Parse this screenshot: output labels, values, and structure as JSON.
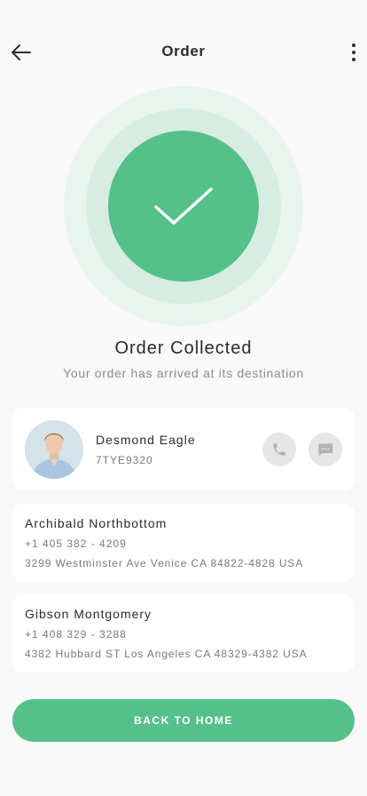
{
  "header": {
    "title": "Order",
    "back_icon": "arrow-left-icon",
    "more_icon": "more-vertical-icon"
  },
  "status": {
    "icon": "check-icon",
    "title": "Order Collected",
    "subtitle": "Your order has arrived at its destination"
  },
  "driver": {
    "name": "Desmond Eagle",
    "code": "7TYE9320",
    "call_icon": "phone-icon",
    "message_icon": "message-icon"
  },
  "addresses": [
    {
      "name": "Archibald Northbottom",
      "phone": "+1 405 382 - 4209",
      "address": "3299 Westminster Ave Venice CA 84822-4828 USA"
    },
    {
      "name": "Gibson Montgomery",
      "phone": "+1 408 329 - 3288",
      "address": "4382 Hubbard ST Los Angeles CA 48329-4382 USA"
    }
  ],
  "actions": {
    "back_home_label": "BACK TO HOME"
  },
  "colors": {
    "accent": "#55c08a",
    "background": "#f9f9f9"
  }
}
